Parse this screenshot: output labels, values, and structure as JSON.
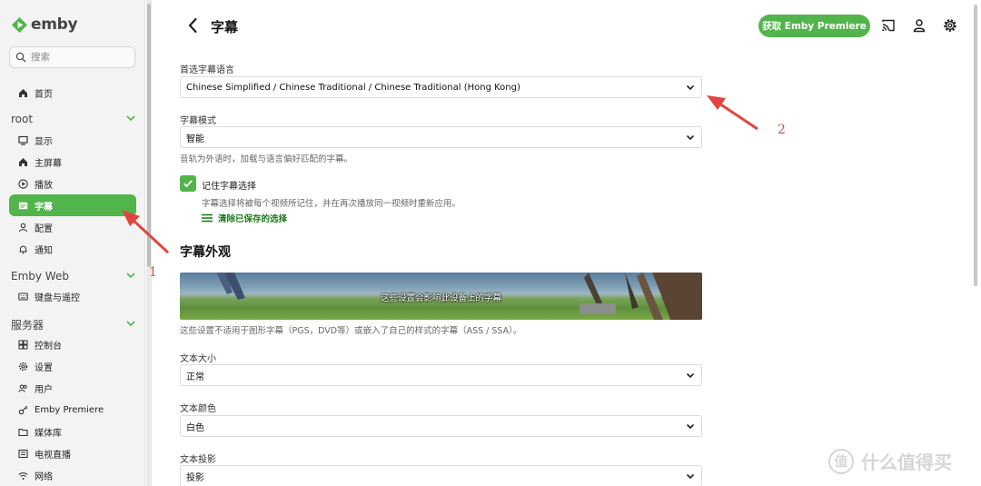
{
  "app": {
    "name": "emby"
  },
  "search": {
    "placeholder": "搜索"
  },
  "sidebar": {
    "home": "首页",
    "section_root": "root",
    "root_items": [
      {
        "label": "显示",
        "icon": "monitor-icon"
      },
      {
        "label": "主屏幕",
        "icon": "home-icon"
      },
      {
        "label": "播放",
        "icon": "play-icon"
      },
      {
        "label": "字幕",
        "icon": "subtitles-icon",
        "active": true
      },
      {
        "label": "配置",
        "icon": "user-icon"
      },
      {
        "label": "通知",
        "icon": "bell-icon"
      }
    ],
    "section_web": "Emby Web",
    "web_items": [
      {
        "label": "键盘与遥控",
        "icon": "keyboard-icon"
      }
    ],
    "section_server": "服务器",
    "server_items": [
      {
        "label": "控制台",
        "icon": "dashboard-icon"
      },
      {
        "label": "设置",
        "icon": "gear-icon"
      },
      {
        "label": "用户",
        "icon": "users-icon"
      },
      {
        "label": "Emby Premiere",
        "icon": "key-icon"
      },
      {
        "label": "媒体库",
        "icon": "folder-icon"
      },
      {
        "label": "电视直播",
        "icon": "tv-icon"
      },
      {
        "label": "网络",
        "icon": "wifi-icon"
      }
    ]
  },
  "header": {
    "title": "字幕",
    "premiere_button": "获取 Emby Premiere"
  },
  "form": {
    "pref_lang_label": "首选字幕语言",
    "pref_lang_value": "Chinese Simplified / Chinese Traditional / Chinese Traditional (Hong Kong)",
    "mode_label": "字幕模式",
    "mode_value": "智能",
    "mode_help": "音轨为外语时，加载与语言偏好匹配的字幕。",
    "remember_label": "记住字幕选择",
    "remember_checked": true,
    "remember_help": "字幕选择将被每个视频所记住，并在再次播放同一视频时重新应用。",
    "clear_link": "清除已保存的选择",
    "appearance_heading": "字幕外观",
    "preview_caption": "这些设置会影响此设备上的字幕",
    "preview_help": "这些设置不适用于图形字幕（PGS，DVD等）或嵌入了自己的样式的字幕（ASS / SSA）。",
    "text_size_label": "文本大小",
    "text_size_value": "正常",
    "text_color_label": "文本颜色",
    "text_color_value": "白色",
    "text_shadow_label": "文本投影",
    "text_shadow_value": "投影"
  },
  "annotations": {
    "one": "1",
    "two": "2"
  },
  "watermark": {
    "text": "什么值得买",
    "logo": "值"
  },
  "colors": {
    "accent": "#52b54b",
    "annotation": "#e0463f"
  }
}
